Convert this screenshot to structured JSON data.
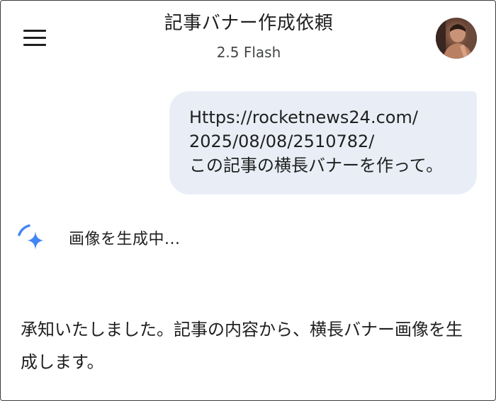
{
  "header": {
    "title": "記事バナー作成依頼",
    "model": "2.5 Flash",
    "menu_icon": "hamburger-menu-icon",
    "avatar_icon": "user-avatar"
  },
  "conversation": {
    "user_message": {
      "lines": [
        "Https://rocketnews24.com/",
        "2025/08/08/2510782/",
        "この記事の横長バナーを作って。"
      ]
    },
    "generating": {
      "icon": "gemini-spark-loading-icon",
      "label": "画像を生成中..."
    },
    "reply": {
      "text": "承知いたしました。記事の内容から、横長バナー画像を生成します。"
    }
  },
  "colors": {
    "bubble": "#e9eef6",
    "spark": "#4285f4",
    "text": "#1f1f1f"
  }
}
